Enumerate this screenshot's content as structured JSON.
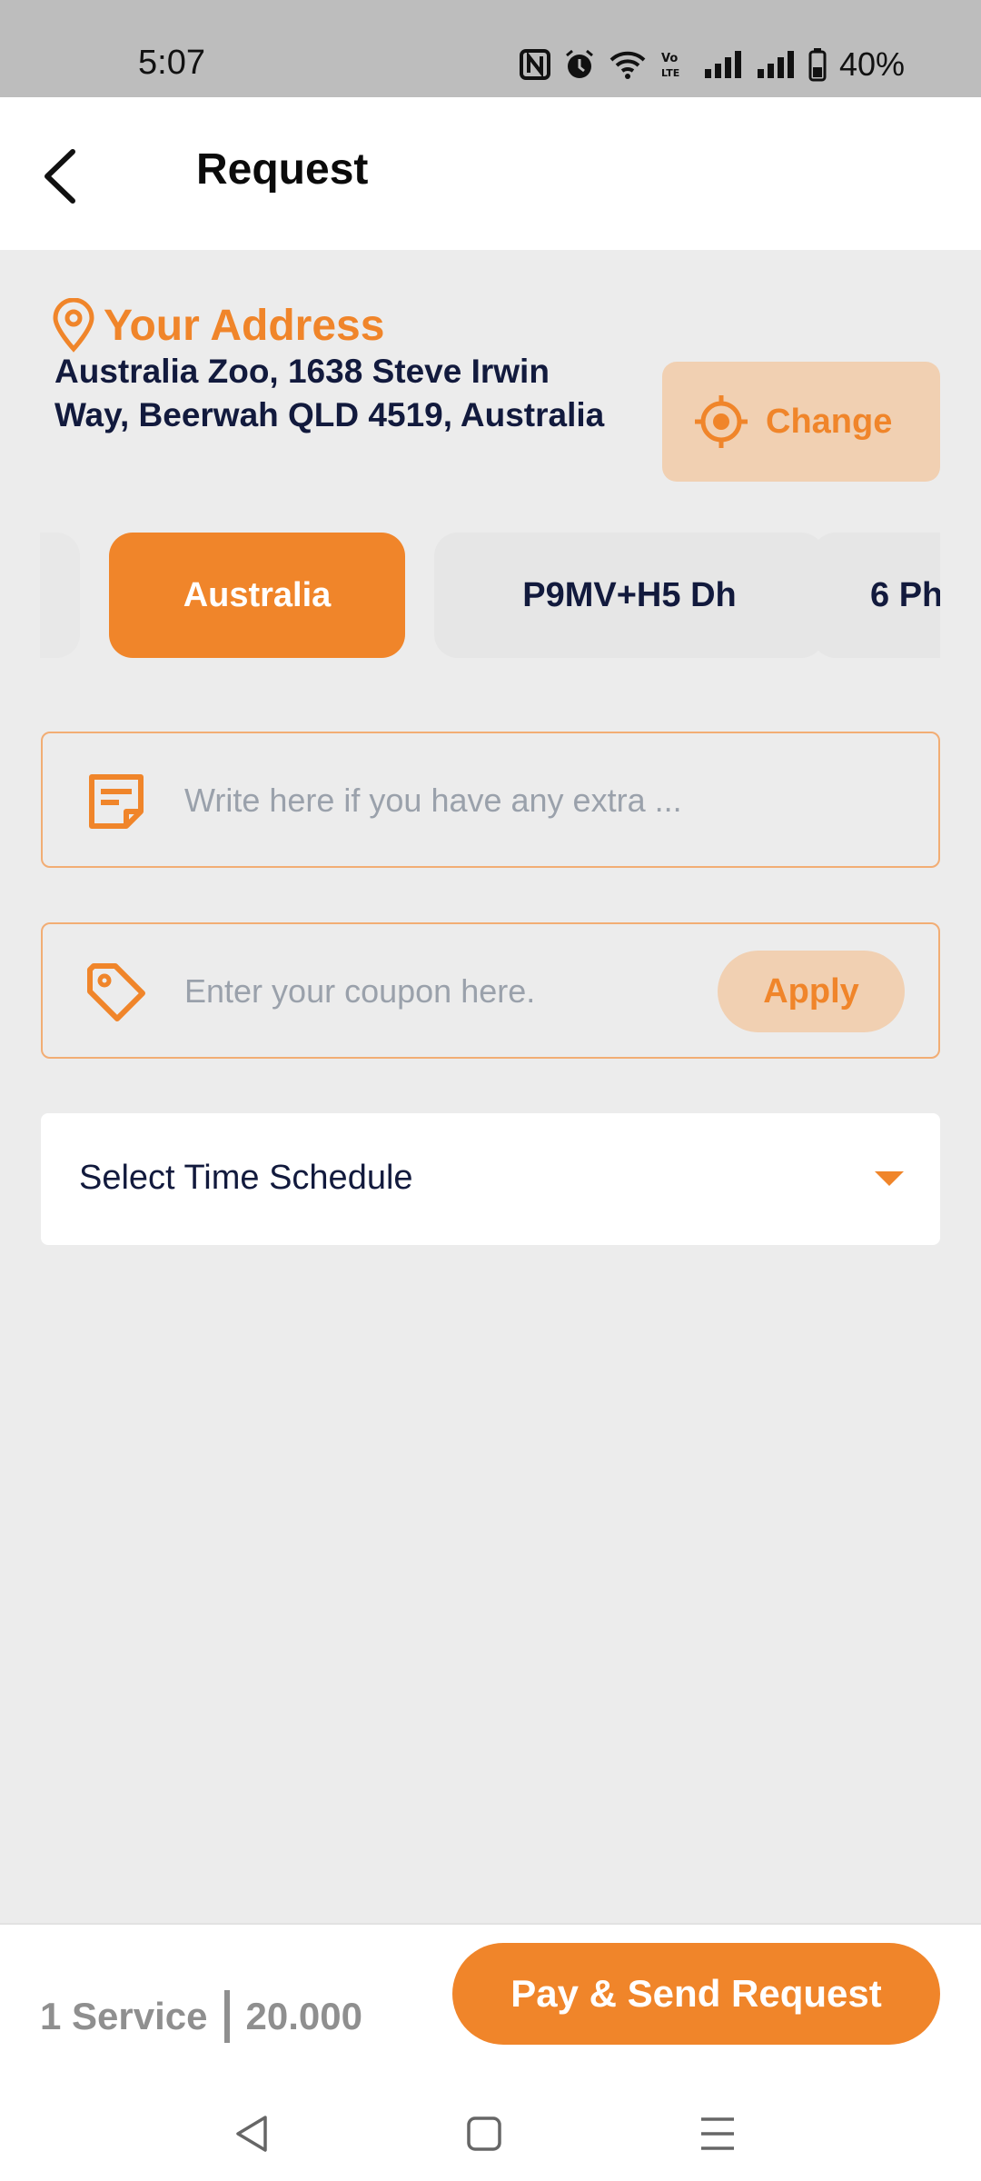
{
  "status_bar": {
    "time": "5:07",
    "battery": "40%",
    "icons": [
      "nfc-icon",
      "alarm-icon",
      "wifi-icon",
      "volte-icon",
      "signal-icon",
      "signal-icon",
      "battery-icon"
    ]
  },
  "header": {
    "title": "Request",
    "back_icon": "back-arrow-icon"
  },
  "address": {
    "heading": "Your Address",
    "icon": "location-pin-icon",
    "text": "Australia Zoo, 1638 Steve Irwin Way, Beerwah QLD 4519, Australia",
    "change_label": "Change",
    "change_icon": "gps-target-icon"
  },
  "address_chips": {
    "items": [
      {
        "label": ""
      },
      {
        "label": "Australia",
        "selected": true
      },
      {
        "label": "P9MV+H5 Dh"
      },
      {
        "label": "6 Ph"
      }
    ]
  },
  "note": {
    "placeholder": "Write here if you have any extra ...",
    "icon": "note-icon"
  },
  "coupon": {
    "placeholder": "Enter your coupon here.",
    "apply_label": "Apply",
    "icon": "tag-icon"
  },
  "schedule": {
    "label": "Select Time Schedule",
    "icon": "dropdown-caret-icon"
  },
  "footer": {
    "service_count": "1 Service",
    "price": "20.000",
    "pay_label": "Pay & Send Request"
  },
  "nav": {
    "icons": [
      "nav-back-icon",
      "nav-home-icon",
      "nav-menu-icon"
    ]
  },
  "colors": {
    "accent": "#f0852a",
    "accent_soft": "#f1d0b2",
    "text_dark": "#121a3d",
    "background": "#ececec"
  }
}
